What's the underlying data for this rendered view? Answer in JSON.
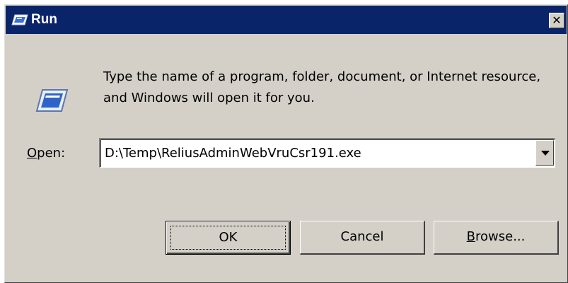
{
  "window": {
    "title": "Run",
    "close_glyph": "✕",
    "title_icon": "run-icon"
  },
  "content": {
    "icon": "run-program-icon",
    "description": "Type the name of a program, folder, document, or Internet resource, and Windows will open it for you.",
    "open_label_mnemonic": "O",
    "open_label_rest": "pen:",
    "open_value": "D:\\Temp\\ReliusAdminWebVruCsr191.exe"
  },
  "buttons": {
    "ok_label": "OK",
    "cancel_label": "Cancel",
    "browse_mnemonic": "B",
    "browse_rest": "rowse..."
  },
  "colors": {
    "titlebar": "#0a246a",
    "face": "#d4d0c8"
  }
}
